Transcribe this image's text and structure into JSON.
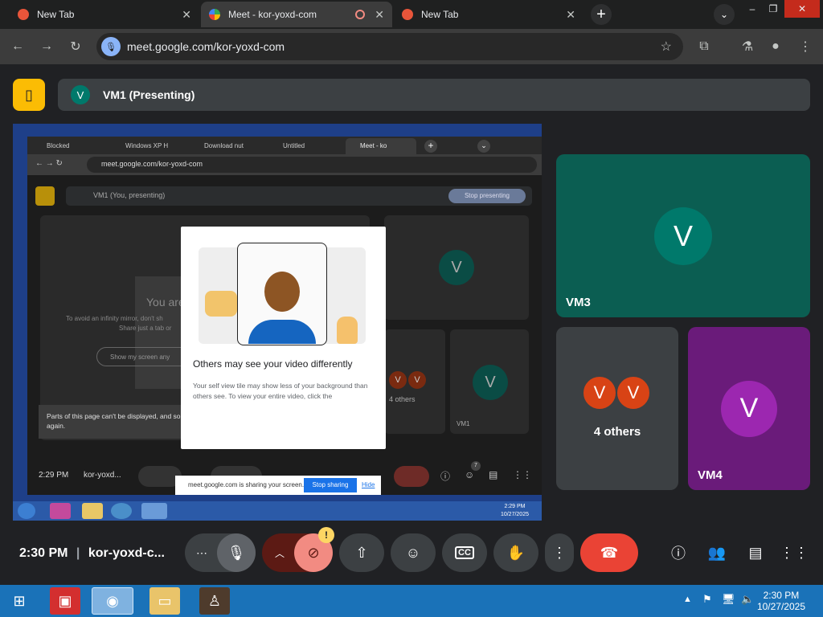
{
  "browser": {
    "tabs": [
      {
        "title": "New Tab",
        "active": false
      },
      {
        "title": "Meet - kor-yoxd-com",
        "active": true
      },
      {
        "title": "New Tab",
        "active": false
      }
    ],
    "url": "meet.google.com/kor-yoxd-com"
  },
  "meet": {
    "presenting_label": "VM1 (Presenting)",
    "presenter_initial": "V",
    "tiles": [
      {
        "name": "VM3",
        "initial": "V",
        "color": "#00796b"
      },
      {
        "name": "4 others",
        "initials": [
          "V",
          "V"
        ],
        "color": "#d84315"
      },
      {
        "name": "VM4",
        "initial": "V",
        "color": "#8e24aa"
      }
    ],
    "time": "2:30 PM",
    "meeting_code": "kor-yoxd-c...",
    "warning_badge": "!"
  },
  "shared_screen": {
    "tabs": [
      "Blocked",
      "Windows XP H",
      "Download nut",
      "Untitled",
      "Meet - ko"
    ],
    "url": "meet.google.com/kor-yoxd-com",
    "presenting_label": "VM1 (You, presenting)",
    "stop_presenting": "Stop presenting",
    "dialog_title": "Others may see your video differently",
    "dialog_body": "Your self view tile may show less of your background than others see. To view your entire video, click the",
    "warning_text": "Parts of this page can't be displayed, and some things might not work properly. Refresh the page and try again.",
    "mirror_title": "You are",
    "mirror_text_1": "To avoid an infinity mirror, don't sh",
    "mirror_text_2": "Share just a tab or",
    "show_screen": "Show my screen any",
    "others_label": "4 others",
    "tile_vm1": "VM1",
    "tile_initial": "V",
    "time": "2:29 PM",
    "code": "kor-yoxd...",
    "sharing_msg": "meet.google.com is sharing your screen.",
    "stop_sharing": "Stop sharing",
    "hide": "Hide",
    "clock_time": "2:29 PM",
    "clock_date": "10/27/2025",
    "badge_7": "7"
  },
  "taskbar": {
    "time": "2:30 PM",
    "date": "10/27/2025"
  }
}
